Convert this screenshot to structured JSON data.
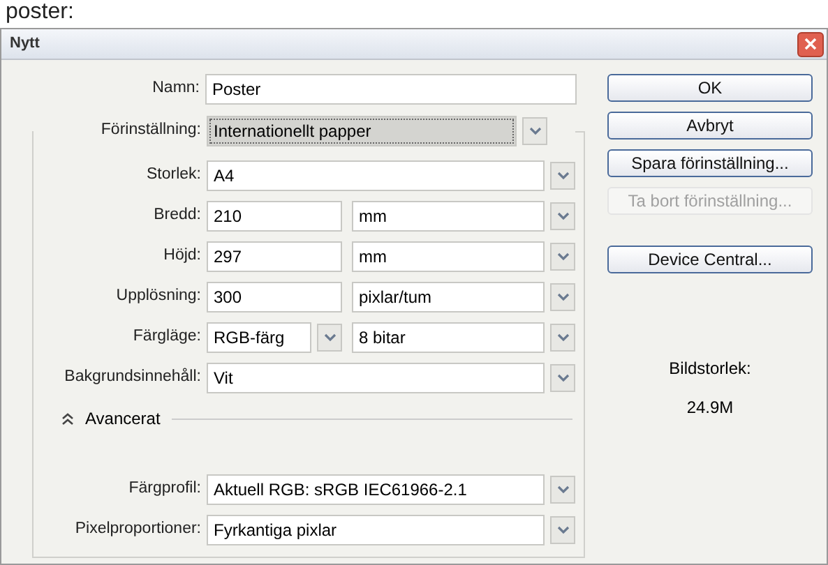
{
  "page_caption": "poster:",
  "window": {
    "title": "Nytt"
  },
  "name_field": {
    "label": "Namn:",
    "value": "Poster"
  },
  "preset": {
    "label": "Förinställning:",
    "value": "Internationellt papper",
    "focused": true
  },
  "fields": [
    {
      "kind": "select",
      "label": "Storlek:",
      "value": "A4"
    },
    {
      "kind": "number",
      "label": "Bredd:",
      "value": "210",
      "unit": "mm"
    },
    {
      "kind": "number",
      "label": "Höjd:",
      "value": "297",
      "unit": "mm"
    },
    {
      "kind": "number",
      "label": "Upplösning:",
      "value": "300",
      "unit": "pixlar/tum"
    },
    {
      "kind": "pair",
      "label": "Färgläge:",
      "value": "RGB-färg",
      "unit": "8 bitar"
    },
    {
      "kind": "select",
      "label": "Bakgrundsinnehåll:",
      "value": "Vit"
    }
  ],
  "advanced": {
    "label": "Avancerat",
    "expanded": true,
    "fields": [
      {
        "kind": "select",
        "label": "Färgprofil:",
        "value": "Aktuell RGB:  sRGB IEC61966-2.1"
      },
      {
        "kind": "select",
        "label": "Pixelproportioner:",
        "value": "Fyrkantiga pixlar"
      }
    ]
  },
  "buttons": [
    {
      "label": "OK",
      "disabled": false
    },
    {
      "label": "Avbryt",
      "disabled": false
    },
    {
      "label": "Spara förinställning...",
      "disabled": false
    },
    {
      "label": "Ta bort förinställning...",
      "disabled": true
    },
    {
      "label": "Device Central...",
      "disabled": false
    }
  ],
  "image_size": {
    "label": "Bildstorlek:",
    "value": "24.9M"
  }
}
